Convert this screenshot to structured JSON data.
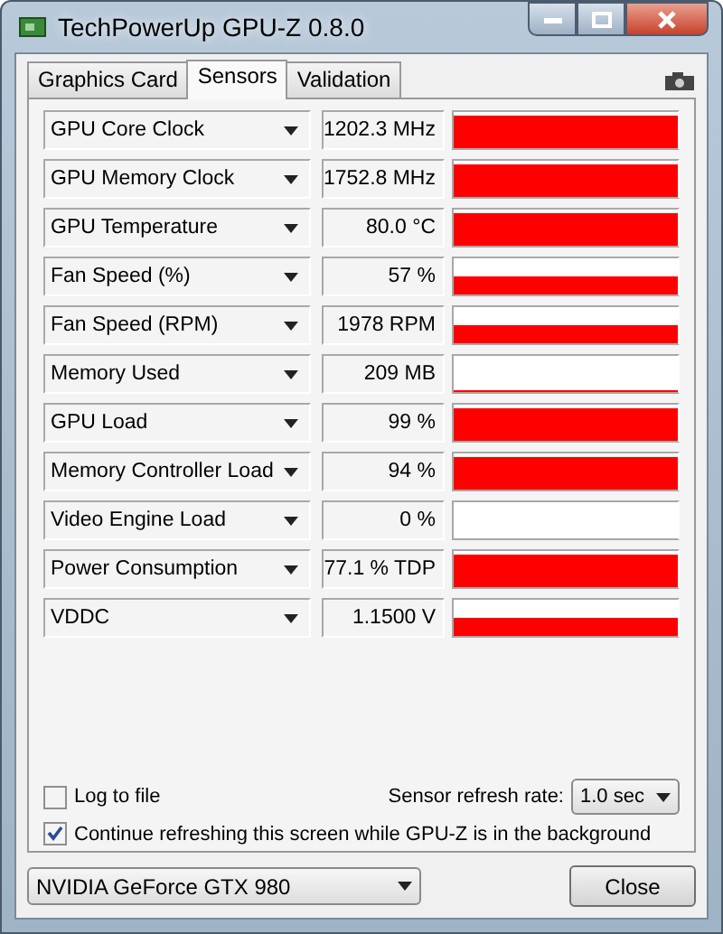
{
  "window": {
    "title": "TechPowerUp GPU-Z 0.8.0"
  },
  "tabs": [
    {
      "label": "Graphics Card",
      "selected": false
    },
    {
      "label": "Sensors",
      "selected": true
    },
    {
      "label": "Validation",
      "selected": false
    }
  ],
  "sensors": [
    {
      "name": "GPU Core Clock",
      "reading": "1202.3 MHz",
      "kind": "high"
    },
    {
      "name": "GPU Memory Clock",
      "reading": "1752.8 MHz",
      "kind": "high"
    },
    {
      "name": "GPU Temperature",
      "reading": "80.0 °C",
      "kind": "high"
    },
    {
      "name": "Fan Speed (%)",
      "reading": "57 %",
      "kind": "mid"
    },
    {
      "name": "Fan Speed (RPM)",
      "reading": "1978 RPM",
      "kind": "mid"
    },
    {
      "name": "Memory Used",
      "reading": "209 MB",
      "kind": "low"
    },
    {
      "name": "GPU Load",
      "reading": "99 %",
      "kind": "high"
    },
    {
      "name": "Memory Controller Load",
      "reading": "94 %",
      "kind": "high"
    },
    {
      "name": "Video Engine Load",
      "reading": "0 %",
      "kind": "flat"
    },
    {
      "name": "Power Consumption",
      "reading": "77.1 % TDP",
      "kind": "high"
    },
    {
      "name": "VDDC",
      "reading": "1.1500 V",
      "kind": "mid"
    }
  ],
  "options": [
    {
      "label": "Log to file",
      "checked": false
    },
    {
      "label": "Continue refreshing this screen while GPU-Z is in the background",
      "checked": true
    }
  ],
  "refresh": {
    "label": "Sensor refresh rate:",
    "value": "1.0 sec"
  },
  "device": {
    "value": "NVIDIA GeForce GTX 980"
  },
  "buttons": [
    {
      "label": "Close"
    }
  ]
}
